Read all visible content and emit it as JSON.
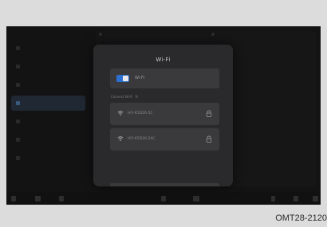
{
  "dialog": {
    "title": "Wi-Fi",
    "toggle_label": "Wi-Fi",
    "toggle_on": true,
    "section_label": "Connect Wi-Fi"
  },
  "networks": [
    {
      "name": "HFI-K5D26-5C",
      "icon": "wifi-icon",
      "secured": true
    },
    {
      "name": "HFI-K5D26-24C",
      "icon": "wifi-icon",
      "secured": true
    }
  ],
  "colors": {
    "accent": "#2b6fd0",
    "dialog_bg": "#2a2a2c",
    "row_bg": "#3a3a3d",
    "screen_bg": "#131313",
    "page_bg": "#dcdcdc"
  },
  "caption": "OMT28-2120"
}
